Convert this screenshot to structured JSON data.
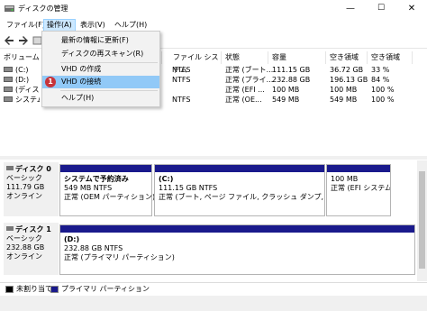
{
  "window": {
    "title": "ディスクの管理",
    "minimize": "—",
    "maximize": "☐",
    "close": "✕"
  },
  "menubar": {
    "items": [
      {
        "label": "ファイル(F)"
      },
      {
        "label": "操作(A)"
      },
      {
        "label": "表示(V)"
      },
      {
        "label": "ヘルプ(H)"
      }
    ]
  },
  "dropdown": {
    "items": [
      {
        "label": "最新の情報に更新(F)"
      },
      {
        "label": "ディスクの再スキャン(R)"
      },
      {
        "label": "VHD の作成"
      },
      {
        "label": "VHD の接続",
        "badge": "1"
      },
      {
        "label": "ヘルプ(H)"
      }
    ]
  },
  "volume_table": {
    "headers": [
      "ボリューム",
      "ファイル システム",
      "状態",
      "容量",
      "空き領域",
      "空き領域"
    ],
    "rows": [
      {
        "volume": "(C:)",
        "fs": "NTFS",
        "status": "正常 (ブート...",
        "capacity": "111.15 GB",
        "free": "36.72 GB",
        "pct": "33 %"
      },
      {
        "volume": "(D:)",
        "fs": "NTFS",
        "status": "正常 (プライ...",
        "capacity": "232.88 GB",
        "free": "196.13 GB",
        "pct": "84 %"
      },
      {
        "volume": "(ディスク",
        "fs": "",
        "status": "正常 (EFI ...",
        "capacity": "100 MB",
        "free": "100 MB",
        "pct": "100 %"
      },
      {
        "volume": "システムで",
        "fs": "NTFS",
        "status": "正常 (OE...",
        "capacity": "549 MB",
        "free": "549 MB",
        "pct": "100 %"
      }
    ]
  },
  "disks": [
    {
      "name": "ディスク 0",
      "type": "ベーシック",
      "size": "111.79 GB",
      "state": "オンライン",
      "partitions": [
        {
          "title": "システムで予約済み",
          "size": "549 MB NTFS",
          "status": "正常 (OEM パーティション)"
        },
        {
          "title": "(C:)",
          "size": "111.15 GB NTFS",
          "status": "正常 (ブート, ページ ファイル, クラッシュ ダンプ, プライマリ パ"
        },
        {
          "title": "",
          "size": "100 MB",
          "status": "正常 (EFI システム パ"
        }
      ]
    },
    {
      "name": "ディスク 1",
      "type": "ベーシック",
      "size": "232.88 GB",
      "state": "オンライン",
      "partitions": [
        {
          "title": "(D:)",
          "size": "232.88 GB NTFS",
          "status": "正常 (プライマリ パーティション)"
        }
      ]
    }
  ],
  "legend": {
    "unallocated": "未割り当て",
    "primary": "プライマリ パーティション"
  },
  "colors": {
    "partition_bar": "#1a1a8c",
    "menu_highlight": "#91c9f7",
    "badge": "#c7343a"
  }
}
